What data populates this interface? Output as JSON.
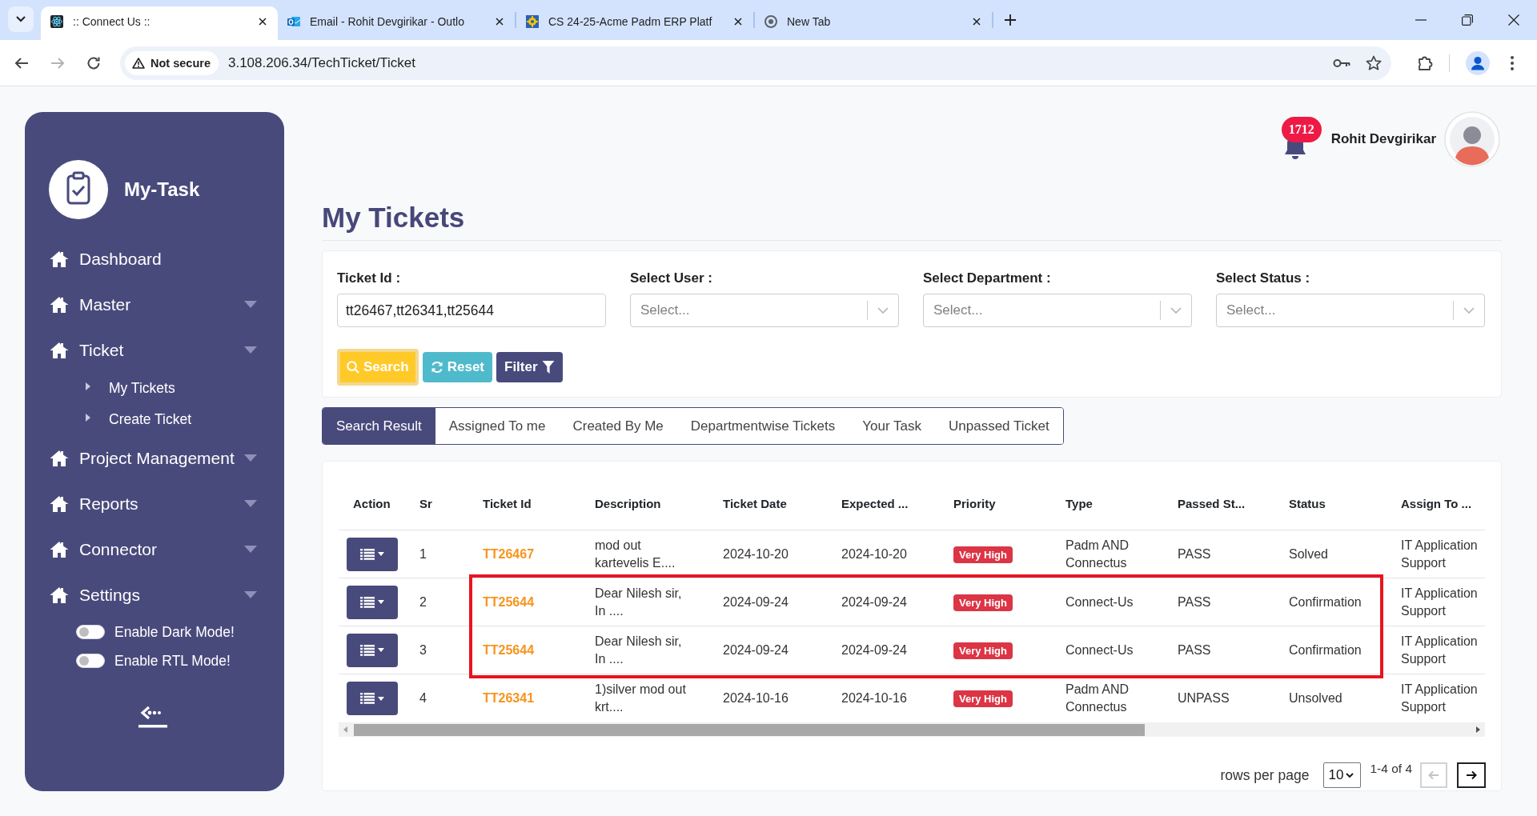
{
  "browser": {
    "tabs": [
      {
        "title": ":: Connect Us ::",
        "selected": true,
        "kind": "atom"
      },
      {
        "title": "Email - Rohit Devgirikar - Outlo",
        "selected": false,
        "kind": "mail"
      },
      {
        "title": "CS 24-25-Acme Padm ERP Platf",
        "selected": false,
        "kind": "gear"
      },
      {
        "title": "New Tab",
        "selected": false,
        "kind": "ring"
      }
    ],
    "forward_disabled": true,
    "security": "Not secure",
    "url": "3.108.206.34/TechTicket/Ticket"
  },
  "sidebar": {
    "brand": "My-Task",
    "items": [
      {
        "label": "Dashboard",
        "has_submenu": false
      },
      {
        "label": "Master",
        "has_submenu": true
      },
      {
        "label": "Ticket",
        "has_submenu": true,
        "children": [
          {
            "label": "My Tickets",
            "kind": "link"
          },
          {
            "label": "Create Ticket",
            "kind": "link"
          }
        ]
      },
      {
        "label": "Project Management",
        "has_submenu": true
      },
      {
        "label": "Reports",
        "has_submenu": true
      },
      {
        "label": "Connector",
        "has_submenu": true
      },
      {
        "label": "Settings",
        "has_submenu": true,
        "children": [
          {
            "label": "Enable Dark Mode!",
            "kind": "toggle",
            "on": false
          },
          {
            "label": "Enable RTL Mode!",
            "kind": "toggle",
            "on": false
          }
        ]
      }
    ]
  },
  "header": {
    "notification_count": "1712",
    "user_name": "Rohit Devgirikar"
  },
  "page_title": "My Tickets",
  "filters": {
    "fields": [
      {
        "label": "Ticket Id :",
        "kind": "text",
        "value": "tt26467,tt26341,tt25644"
      },
      {
        "label": "Select User :",
        "kind": "select",
        "placeholder": "Select..."
      },
      {
        "label": "Select Department :",
        "kind": "select",
        "placeholder": "Select..."
      },
      {
        "label": "Select Status :",
        "kind": "select",
        "placeholder": "Select..."
      }
    ],
    "buttons": [
      {
        "label": "Search",
        "kind": "search",
        "focused": true
      },
      {
        "label": "Reset",
        "kind": "reset",
        "focused": false
      },
      {
        "label": "Filter",
        "kind": "filter",
        "focused": false
      }
    ]
  },
  "result_tabs": [
    {
      "label": "Search Result",
      "selected": true
    },
    {
      "label": "Assigned To me",
      "selected": false
    },
    {
      "label": "Created By Me",
      "selected": false
    },
    {
      "label": "Departmentwise Tickets",
      "selected": false
    },
    {
      "label": "Your Task",
      "selected": false
    },
    {
      "label": "Unpassed Ticket",
      "selected": false
    }
  ],
  "table": {
    "columns": [
      "Action",
      "Sr",
      "Ticket Id",
      "Description",
      "Ticket Date",
      "Expected ...",
      "Priority",
      "Type",
      "Passed St...",
      "Status",
      "Assign To ..."
    ],
    "rows": [
      {
        "sr": "1",
        "ticket_id": "TT26467",
        "description": "mod out kartevelis E....",
        "ticket_date": "2024-10-20",
        "expected": "2024-10-20",
        "priority": "Very High",
        "type": "Padm AND Connectus",
        "passed_st": "PASS",
        "status": "Solved",
        "assign_to": "IT Application Support",
        "highlighted": false
      },
      {
        "sr": "2",
        "ticket_id": "TT25644",
        "description": "Dear Nilesh sir, In ....",
        "ticket_date": "2024-09-24",
        "expected": "2024-09-24",
        "priority": "Very High",
        "type": "Connect-Us",
        "passed_st": "PASS",
        "status": "Confirmation",
        "assign_to": "IT Application Support",
        "highlighted": true
      },
      {
        "sr": "3",
        "ticket_id": "TT25644",
        "description": "Dear Nilesh sir, In ....",
        "ticket_date": "2024-09-24",
        "expected": "2024-09-24",
        "priority": "Very High",
        "type": "Connect-Us",
        "passed_st": "PASS",
        "status": "Confirmation",
        "assign_to": "IT Application Support",
        "highlighted": true
      },
      {
        "sr": "4",
        "ticket_id": "TT26341",
        "description": "1)silver mod out krt....",
        "ticket_date": "2024-10-16",
        "expected": "2024-10-16",
        "priority": "Very High",
        "type": "Padm AND Connectus",
        "passed_st": "UNPASS",
        "status": "Unsolved",
        "assign_to": "IT Application Support",
        "highlighted": false
      }
    ]
  },
  "pagination": {
    "label": "rows per page",
    "page_size": "10",
    "range": "1-4 of 4",
    "prev_disabled": true,
    "next_disabled": false
  }
}
